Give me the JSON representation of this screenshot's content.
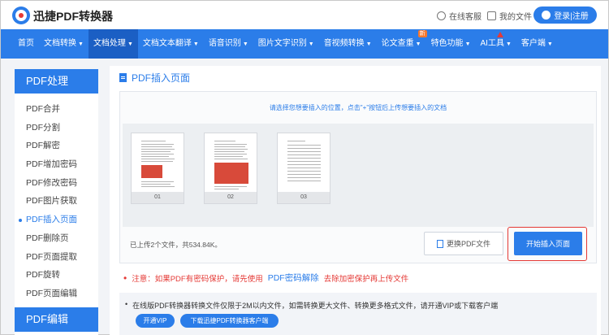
{
  "header": {
    "brand": "迅捷PDF转换器",
    "support": "在线客服",
    "my_files": "我的文件",
    "login": "登录|注册"
  },
  "nav": {
    "items": [
      {
        "label": "首页",
        "dropdown": false
      },
      {
        "label": "文档转换",
        "dropdown": true
      },
      {
        "label": "文档处理",
        "dropdown": true,
        "active": true
      },
      {
        "label": "文档文本翻译",
        "dropdown": true
      },
      {
        "label": "语音识别",
        "dropdown": true
      },
      {
        "label": "图片文字识别",
        "dropdown": true
      },
      {
        "label": "音视频转换",
        "dropdown": true
      },
      {
        "label": "论文查重",
        "dropdown": true,
        "badge": "新"
      },
      {
        "label": "特色功能",
        "dropdown": true
      },
      {
        "label": "AI工具",
        "dropdown": true
      },
      {
        "label": "客户端",
        "dropdown": true
      }
    ]
  },
  "sidebar": {
    "section1": "PDF处理",
    "items": [
      "PDF合并",
      "PDF分割",
      "PDF解密",
      "PDF增加密码",
      "PDF修改密码",
      "PDF图片获取",
      "PDF插入页面",
      "PDF删除页",
      "PDF页面提取",
      "PDF旋转",
      "PDF页面编辑"
    ],
    "active_item": "PDF插入页面",
    "section2": "PDF编辑"
  },
  "main": {
    "title": "PDF插入页面",
    "instruction": "请选择您想要插入的位置，点击\"+\"按钮后上传想要插入的文档",
    "thumbnails": [
      "01",
      "02",
      "03"
    ],
    "file_info": "已上传2个文件，共534.84K。",
    "replace_button": "更换PDF文件",
    "start_button": "开始插入页面"
  },
  "notice": {
    "bullet": "•",
    "prefix": "注意：如果PDF有密码保护，请先使用",
    "link": "PDF密码解除",
    "suffix": "去除加密保护再上传文件"
  },
  "bottom": {
    "bullet": "•",
    "text": "在线版PDF转换器转换文件仅限于2M以内文件，如需转换更大文件、转换更多格式文件，请开通VIP或下载客户端",
    "vip_button": "开通VIP",
    "download_button": "下载迅捷PDF转换器客户端"
  },
  "colors": {
    "primary": "#2b7de9",
    "nav_active": "#1b5fc4",
    "warning": "#e53935"
  }
}
